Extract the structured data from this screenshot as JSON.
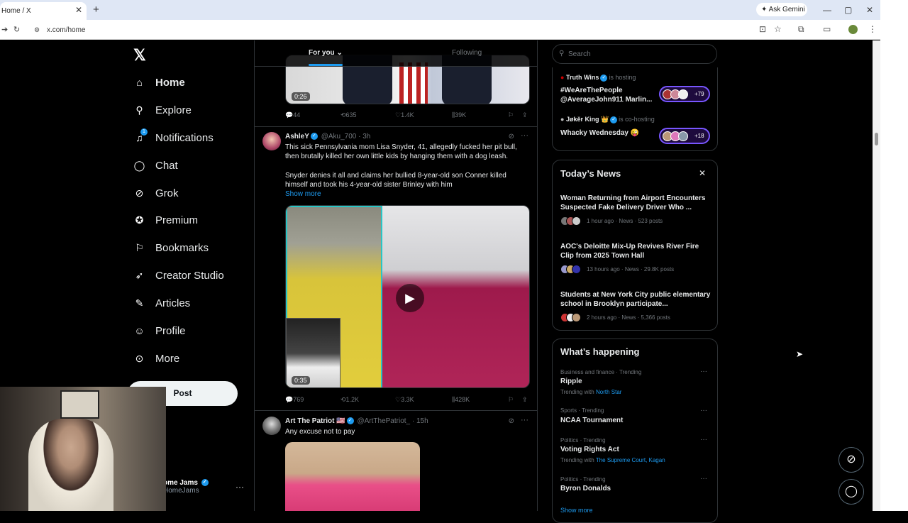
{
  "browser": {
    "tab_title": "Home / X",
    "tab_close": "✕",
    "new_tab": "+",
    "address": "x.com/home",
    "gemini_label": "Ask Gemini",
    "minimize": "—",
    "restore": "▢",
    "close": "✕"
  },
  "sidebar": {
    "logo": "𝕏",
    "notification_count": "1",
    "items": [
      {
        "label": "Home",
        "icon": "home-icon"
      },
      {
        "label": "Explore",
        "icon": "search-icon"
      },
      {
        "label": "Notifications",
        "icon": "bell-icon"
      },
      {
        "label": "Chat",
        "icon": "chat-icon"
      },
      {
        "label": "Grok",
        "icon": "grok-icon"
      },
      {
        "label": "Premium",
        "icon": "premium-icon"
      },
      {
        "label": "Bookmarks",
        "icon": "bookmark-icon"
      },
      {
        "label": "Creator Studio",
        "icon": "rocket-icon"
      },
      {
        "label": "Articles",
        "icon": "article-icon"
      },
      {
        "label": "Profile",
        "icon": "person-icon"
      },
      {
        "label": "More",
        "icon": "more-circle-icon"
      }
    ],
    "post_button": "Post",
    "account": {
      "name": "ome Jams",
      "handle": "HomeJams",
      "more": "···"
    }
  },
  "feed": {
    "tabs": [
      {
        "label": "For you ⌄"
      },
      {
        "label": "Following"
      }
    ],
    "top_media_duration": "0:26",
    "top_actions": {
      "replies": "44",
      "reposts": "635",
      "likes": "1.4K",
      "views": "39K"
    },
    "posts": [
      {
        "name": "AshleY",
        "handle": "@Aku_700",
        "time": "· 3h",
        "text1": "This sick Pennsylvania mom Lisa Snyder, 41, allegedly fucked her pit bull, then brutally killed her own little kids by hanging them with a dog leash.",
        "text2": "Snyder denies it all and claims her bullied 8-year-old son Conner killed himself and took his 4-year-old sister Brinley with him",
        "show_more": "Show more",
        "duration": "0:35",
        "actions": {
          "replies": "769",
          "reposts": "1.2K",
          "likes": "3.3K",
          "views": "428K"
        }
      },
      {
        "name": "Art The Patriot 🇺🇸",
        "handle": "@ArtThePatriot_",
        "time": "· 15h",
        "text1": "Any excuse not to pay"
      }
    ]
  },
  "right": {
    "search_placeholder": "Search",
    "spaces": [
      {
        "host": "Truth Wins",
        "role": "is hosting",
        "title": "#WeAreThePeople @AverageJohn911 Marlin...",
        "count": "+79"
      },
      {
        "host": "Jøkěr King 👑",
        "role": "is co-hosting",
        "title": "Whacky Wednesday 😜",
        "count": "+18"
      }
    ],
    "news": {
      "title": "Today’s News",
      "close": "✕",
      "items": [
        {
          "headline": "Woman Returning from Airport Encounters Suspected Fake Delivery Driver Who ...",
          "meta": "1 hour ago · News · 523 posts"
        },
        {
          "headline": "AOC's Deloitte Mix-Up Revives River Fire Clip from 2025 Town Hall",
          "meta": "13 hours ago · News · 29.8K posts"
        },
        {
          "headline": "Students at New York City public elementary school in Brooklyn participate...",
          "meta": "2 hours ago · News · 5,366 posts"
        }
      ]
    },
    "happening": {
      "title": "What’s happening",
      "items": [
        {
          "category": "Business and finance · Trending",
          "name": "Ripple",
          "with_prefix": "Trending with",
          "with": "North Star"
        },
        {
          "category": "Sports · Trending",
          "name": "NCAA Tournament"
        },
        {
          "category": "Politics · Trending",
          "name": "Voting Rights Act",
          "with_prefix": "Trending with",
          "with": "The Supreme Court, Kagan"
        },
        {
          "category": "Politics · Trending",
          "name": "Byron Donalds"
        }
      ],
      "show_more": "Show more"
    }
  }
}
